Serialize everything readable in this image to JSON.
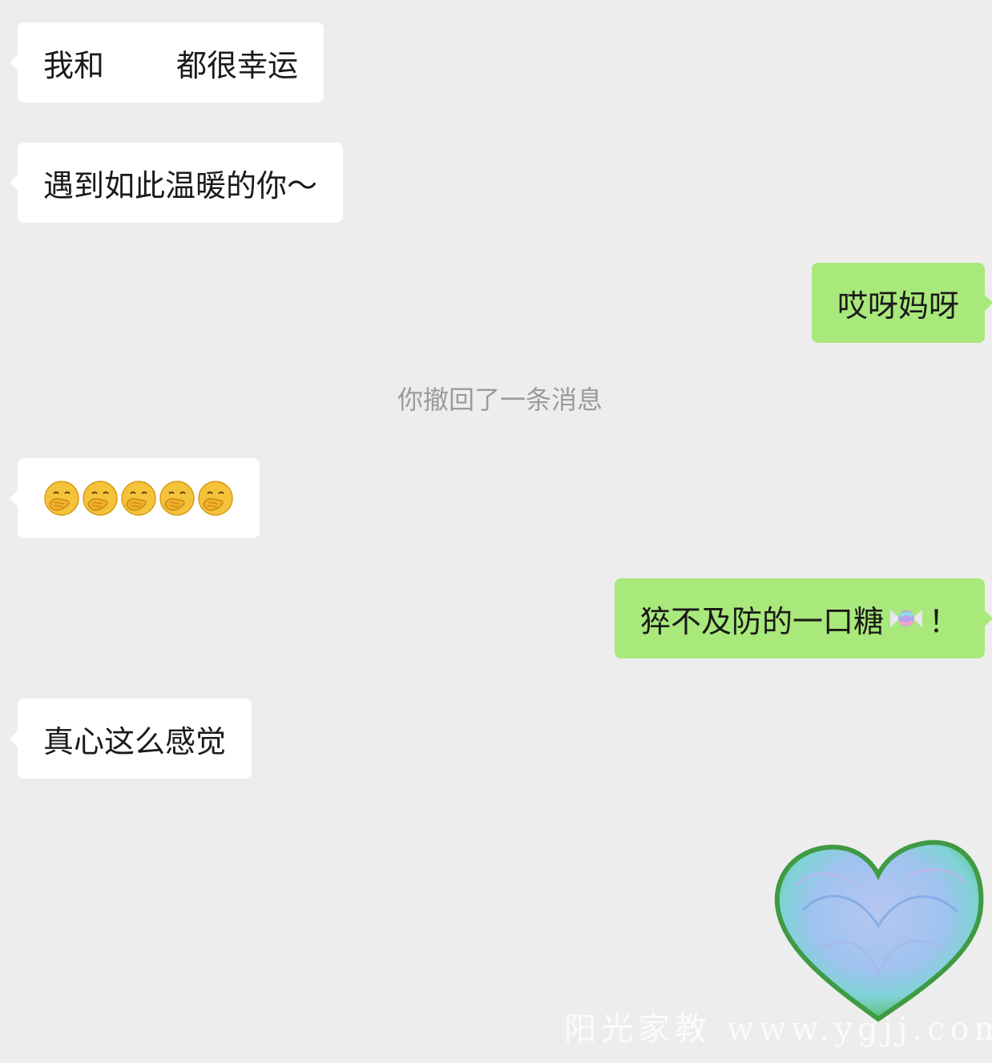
{
  "messages": [
    {
      "side": "in",
      "before": "我和",
      "after": "都很幸运"
    },
    {
      "side": "in",
      "text": "遇到如此温暖的你～"
    },
    {
      "side": "out",
      "text": "哎呀妈呀"
    },
    {
      "side": "system",
      "text": "你撤回了一条消息"
    },
    {
      "side": "in",
      "emoji": "hand-over-mouth-emoji",
      "count": 5
    },
    {
      "side": "out",
      "before": "猝不及防的一口糖",
      "icon": "candy-emoji",
      "after": "！"
    },
    {
      "side": "in",
      "text": "真心这么感觉"
    },
    {
      "side": "out",
      "sticker": "heart-sticker"
    }
  ],
  "colors": {
    "background": "#ededed",
    "incoming_bubble": "#ffffff",
    "outgoing_bubble": "#a9e87a",
    "system_text": "#9b9b9b"
  },
  "watermark": "阳光家教 www.ygjj.com"
}
